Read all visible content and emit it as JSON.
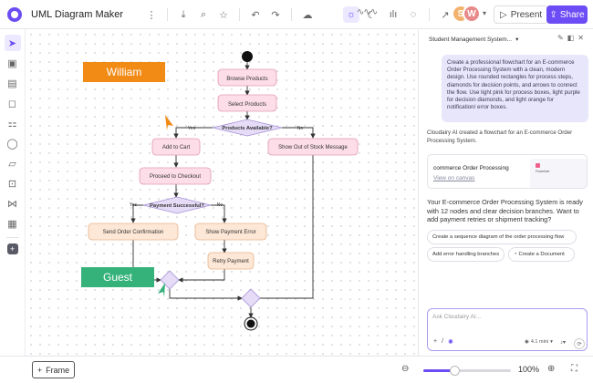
{
  "app": {
    "title": "UML Diagram Maker",
    "present_label": "Present",
    "share_label": "Share"
  },
  "avatars": [
    {
      "initial": "S",
      "color": "#f3b36e"
    },
    {
      "initial": "W",
      "color": "#e88a8a"
    }
  ],
  "toolbar": {
    "icons": [
      "download-icon",
      "search-icon",
      "star-icon",
      "undo-icon",
      "redo-icon",
      "cloud-icon"
    ],
    "right_icons": [
      "chart-icon",
      "comment-icon",
      "connector-icon"
    ],
    "collab_label": "~~~~"
  },
  "left_tools": [
    "cursor-icon",
    "frame-icon",
    "text-icon",
    "shape-icon",
    "component-icon",
    "chat-icon",
    "sticky-icon",
    "image-icon",
    "connect-icon",
    "template-icon",
    "add-icon"
  ],
  "diagram": {
    "nodes": {
      "browse": "Browse Products",
      "select": "Select Products",
      "available": "Products Available?",
      "add_cart": "Add to Cart",
      "out_stock": "Show Out of Stock Message",
      "checkout": "Proceed to Checkout",
      "payment_ok": "Payment Successful?",
      "confirm": "Send Order Confirmation",
      "pay_error": "Show Payment Error",
      "retry": "Retry Payment"
    },
    "yes1": "Yes",
    "no1": "No",
    "yes2": "Yes",
    "no2": "No"
  },
  "cursors": {
    "william": {
      "name": "William",
      "color": "#f28a16"
    },
    "guest": {
      "name": "Guest",
      "color": "#35b27a"
    }
  },
  "bottom": {
    "frame_label": "Frame",
    "zoom_text": "100%",
    "zoom_fraction": 0.35
  },
  "panel": {
    "chat_title": "Student Management System...",
    "user_message": "Create a professional flowchart for an E-commerce Order Processing System with a clean, modern design. Use rounded rectangles for process steps, diamonds for decision points, and arrows to connect the flow. Use light pink for process boxes, light purple for decision diamonds, and light orange for notification/ error boxes.",
    "ai_created": "Cloudairy AI created a flowchart for an E-commerce Order Processing System.",
    "card_title": "commerce Order Processing",
    "card_link": "View on canvas",
    "card_thumb_label": "Flowchart",
    "ai_summary": "Your E-commerce Order Processing System is ready with 12 nodes and clear decision branches. Want to add payment retries or shipment tracking?",
    "chips": [
      "Create a sequence diagram of the order processing flow",
      "Add error handling branches",
      "Create a Document"
    ],
    "input_placeholder": "Ask Cloudairy AI...",
    "model_label": "4.1 mini"
  }
}
